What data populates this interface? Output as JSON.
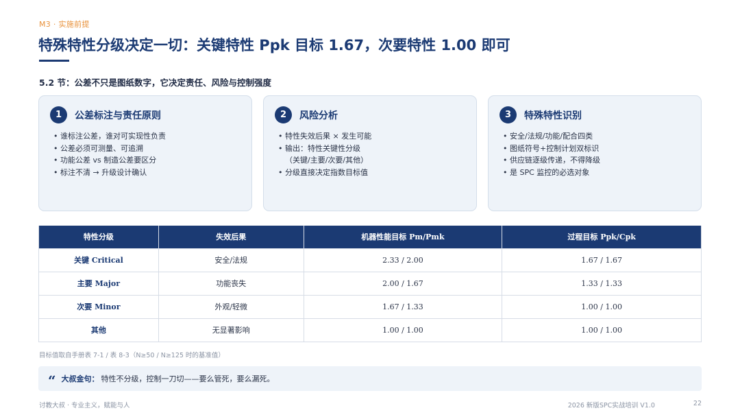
{
  "header": {
    "tag": "M3 · 实施前提",
    "title": "特殊特性分级决定一切：关键特性 Ppk 目标 1.67，次要特性 1.00 即可",
    "subtitle": "5.2 节：公差不只是图纸数字，它决定责任、风险与控制强度"
  },
  "cards": [
    {
      "num": "1",
      "title": "公差标注与责任原则",
      "items": [
        "谁标注公差，谁对可实现性负责",
        "公差必须可测量、可追溯",
        "功能公差 vs 制造公差要区分",
        "标注不清 → 升级设计确认"
      ]
    },
    {
      "num": "2",
      "title": "风险分析",
      "items": [
        "特性失效后果 × 发生可能",
        "输出：特性关键性分级",
        "（关键/主要/次要/其他）",
        "分级直接决定指数目标值"
      ]
    },
    {
      "num": "3",
      "title": "特殊特性识别",
      "items": [
        "安全/法规/功能/配合四类",
        "图纸符号+控制计划双标识",
        "供应链逐级传递，不得降级",
        "是 SPC 监控的必选对象"
      ]
    }
  ],
  "table": {
    "headers": [
      "特性分级",
      "失效后果",
      "机器性能目标 Pm/Pmk",
      "过程目标 Ppk/Cpk"
    ],
    "rows": [
      [
        "关键 Critical",
        "安全/法规",
        "2.33 / 2.00",
        "1.67 / 1.67"
      ],
      [
        "主要 Major",
        "功能丧失",
        "2.00 / 1.67",
        "1.33 / 1.33"
      ],
      [
        "次要 Minor",
        "外观/轻微",
        "1.67 / 1.33",
        "1.00 / 1.00"
      ],
      [
        "其他",
        "无显著影响",
        "1.00 / 1.00",
        "1.00 / 1.00"
      ]
    ]
  },
  "note": "目标值取自手册表 7-1 / 表 8-3（N≥50 / N≥125 时的基准值）",
  "quote": {
    "label": "大叔金句：",
    "text": "特性不分级，控制一刀切——要么管死，要么漏死。"
  },
  "footer": {
    "left": "讨教大叔 · 专业主义，赋能与人",
    "course": "2026 新版SPC实战培训 V1.0",
    "page": "22"
  },
  "colors": {
    "primary": "#1b3a73",
    "accent": "#e8913a",
    "card_bg": "#eef3f9"
  }
}
